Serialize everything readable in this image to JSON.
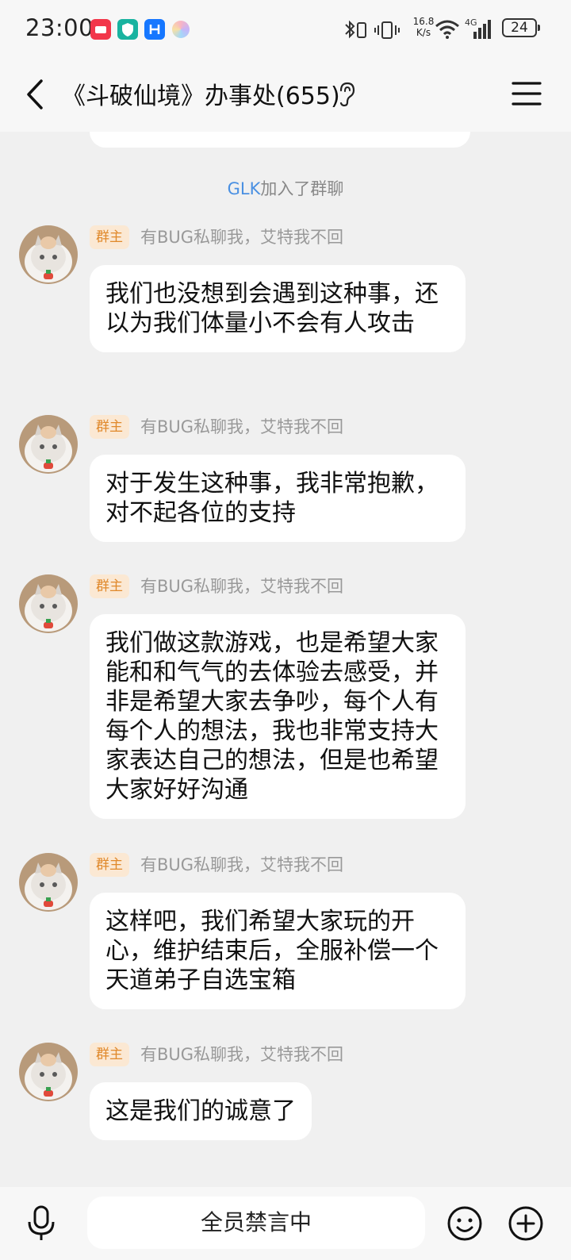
{
  "status_bar": {
    "time": "23:00",
    "net_speed_value": "16.8",
    "net_speed_unit": "K/s",
    "network_type": "4G",
    "battery": "24"
  },
  "header": {
    "title": "《斗破仙境》办事处(655)"
  },
  "system_notice": {
    "name": "GLK",
    "text": "加入了群聊"
  },
  "messages": [
    {
      "badge": "群主",
      "sender": "有BUG私聊我，艾特我不回",
      "text": "我们也没想到会遇到这种事，还以为我们体量小不会有人攻击"
    },
    {
      "badge": "群主",
      "sender": "有BUG私聊我，艾特我不回",
      "text": "对于发生这种事，我非常抱歉，对不起各位的支持"
    },
    {
      "badge": "群主",
      "sender": "有BUG私聊我，艾特我不回",
      "text": "我们做这款游戏，也是希望大家能和和气气的去体验去感受，并非是希望大家去争吵，每个人有每个人的想法，我也非常支持大家表达自己的想法，但是也希望大家好好沟通"
    },
    {
      "badge": "群主",
      "sender": "有BUG私聊我，艾特我不回",
      "text": "这样吧，我们希望大家玩的开心，维护结束后，全服补偿一个天道弟子自选宝箱"
    },
    {
      "badge": "群主",
      "sender": "有BUG私聊我，艾特我不回",
      "text": "这是我们的诚意了"
    }
  ],
  "input_bar": {
    "mute_text": "全员禁言中"
  },
  "colors": {
    "background": "#f0f0f0",
    "bubble": "#ffffff",
    "badge_text": "#e0892b",
    "badge_bg": "#fbe8d3",
    "link": "#4a90e2"
  }
}
